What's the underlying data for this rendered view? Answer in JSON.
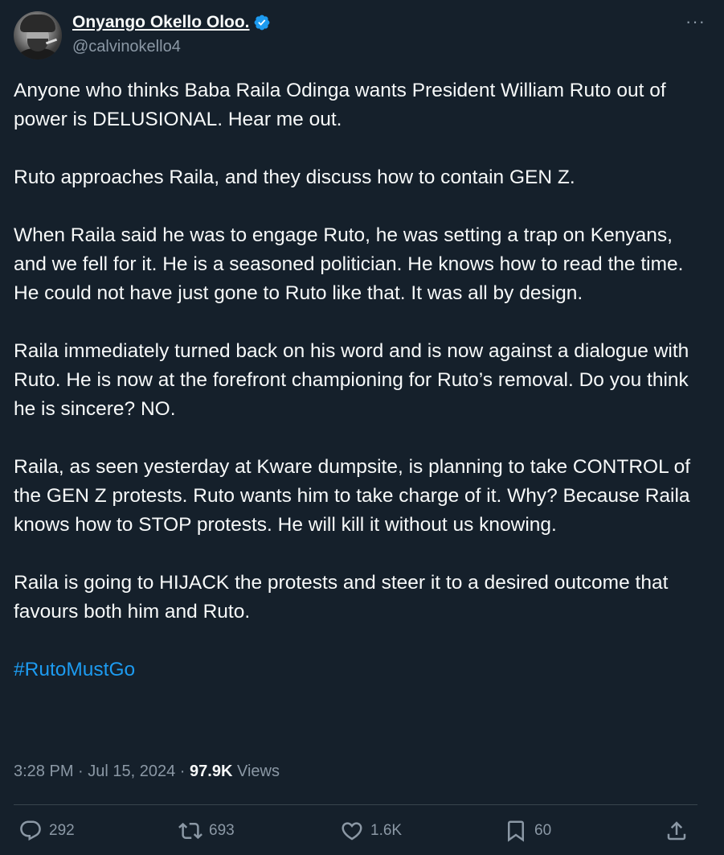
{
  "author": {
    "display_name": "Onyango Okello Oloo.",
    "handle": "@calvinokello4",
    "verified_color": "#1d9bf0"
  },
  "more_icon": "more-horizontal-icon",
  "tweet": {
    "paragraphs": [
      "Anyone who thinks Baba Raila Odinga wants President William Ruto out of power is DELUSIONAL. Hear me out.",
      "Ruto approaches Raila, and they discuss how to contain GEN Z.",
      "When Raila said he was to engage Ruto, he was setting a trap on Kenyans, and we fell for it. He is a seasoned politician. He knows how to read the time. He could not have just gone to Ruto like that. It was all by design.",
      "Raila immediately turned back on his word and is now against a dialogue with Ruto. He is now at the forefront championing for Ruto’s removal. Do you think he is sincere? NO.",
      "Raila, as seen yesterday at Kware dumpsite, is planning to take CONTROL of the GEN Z protests. Ruto wants him to take charge of it. Why? Because Raila knows how to STOP protests. He will kill it without us knowing.",
      "Raila is going to HIJACK the protests and steer it to a desired outcome that favours both him and Ruto."
    ],
    "hashtag": "#RutoMustGo"
  },
  "meta": {
    "time": "3:28 PM",
    "sep1": " · ",
    "date": "Jul 15, 2024",
    "sep2": " · ",
    "views_count": "97.9K",
    "views_label": " Views"
  },
  "actions": {
    "replies": "292",
    "retweets": "693",
    "likes": "1.6K",
    "bookmarks": "60"
  },
  "colors": {
    "background": "#15202b",
    "text": "#f7f9f9",
    "secondary": "#8b98a5",
    "accent": "#1d9bf0",
    "divider": "#38444d"
  }
}
